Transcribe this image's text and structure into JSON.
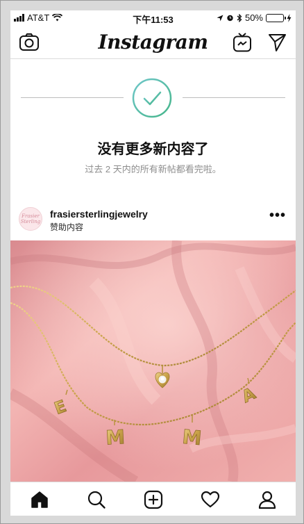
{
  "status_bar": {
    "carrier": "AT&T",
    "time": "下午11:53",
    "battery": "50%",
    "battery_level": 0.5
  },
  "header": {
    "logo": "Instagram",
    "icons": [
      "camera-icon",
      "igtv-icon",
      "direct-message-icon"
    ]
  },
  "feed_end": {
    "title": "没有更多新内容了",
    "subtitle": "过去 2 天内的所有新帖都看完啦。"
  },
  "post": {
    "username": "frasiersterlingjewelry",
    "label": "赞助内容",
    "avatar_text_1": "Frasier",
    "avatar_text_2": "Sterling",
    "more": "•••",
    "pendant_letters": [
      "E",
      "M",
      "M",
      "A"
    ]
  },
  "tabs": [
    "home-icon",
    "search-icon",
    "new-post-icon",
    "activity-icon",
    "profile-icon"
  ],
  "colors": {
    "check_accent": "#4fb9a6",
    "photo_pink": "#e79b9e",
    "gold": "#c9a24a",
    "battery_fill": "#f5c518"
  }
}
